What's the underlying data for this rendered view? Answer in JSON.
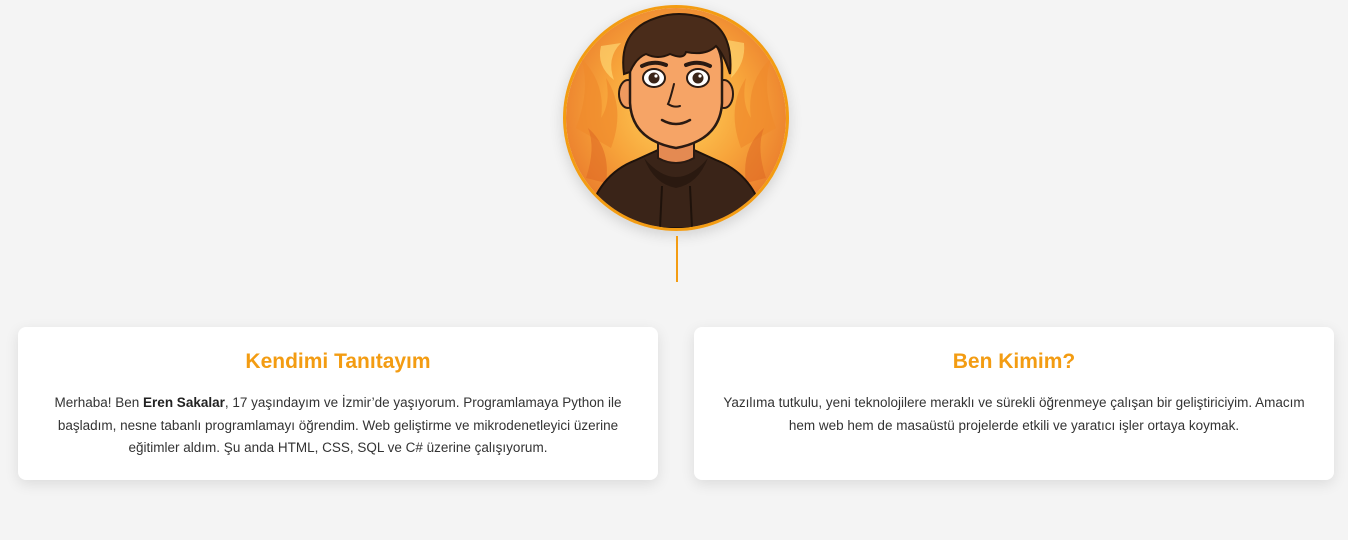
{
  "colors": {
    "accent": "#f39c12",
    "background": "#f4f4f4",
    "card": "#ffffff"
  },
  "avatar": {
    "icon": "cartoon-portrait-avatar"
  },
  "intro_card": {
    "title": "Kendimi Tanıtayım",
    "text_before": "Merhaba! Ben ",
    "name": "Eren Sakalar",
    "text_after": ", 17 yaşındayım ve İzmir’de yaşıyorum. Programlamaya Python ile başladım, nesne tabanlı programlamayı öğrendim. Web geliştirme ve mikrodenetleyici üzerine eğitimler aldım. Şu anda HTML, CSS, SQL ve C# üzerine çalışıyorum."
  },
  "about_card": {
    "title": "Ben Kimim?",
    "text": "Yazılıma tutkulu, yeni teknolojilere meraklı ve sürekli öğrenmeye çalışan bir geliştiriciyim. Amacım hem web hem de masaüstü projelerde etkili ve yaratıcı işler ortaya koymak."
  }
}
